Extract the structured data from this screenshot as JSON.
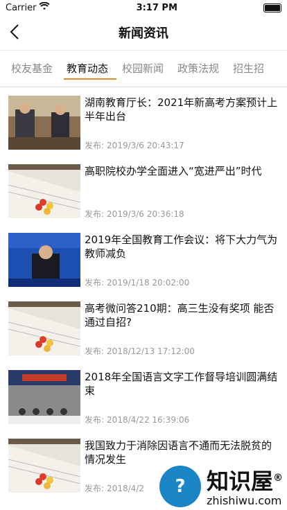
{
  "status": {
    "carrier": "Carrier",
    "time": "3:17 PM"
  },
  "nav": {
    "title": "新闻资讯"
  },
  "tabs": [
    {
      "label": "校友基金"
    },
    {
      "label": "教育动态"
    },
    {
      "label": "校园新闻"
    },
    {
      "label": "政策法规"
    },
    {
      "label": "招生招"
    }
  ],
  "items": [
    {
      "title": "湖南教育厅长：2021年新高考方案预计上半年出台",
      "pub": "发布:",
      "date": "2019/3/6 20:43:17"
    },
    {
      "title": "高职院校办学全面进入“宽进严出”时代",
      "pub": "发布:",
      "date": "2019/3/6 20:36:18"
    },
    {
      "title": "2019年全国教育工作会议：将下大力气为教师减负",
      "pub": "发布:",
      "date": "2019/1/18 20:02:00"
    },
    {
      "title": "高考微问答210期：高三生没有奖项 能否通过自招?",
      "pub": "发布:",
      "date": "2018/12/13 17:12:00"
    },
    {
      "title": "2018年全国语言文字工作督导培训圆满结束",
      "pub": "发布:",
      "date": "2018/4/22 16:39:06"
    },
    {
      "title": "我国致力于消除因语言不通而无法脱贫的情况发生",
      "pub": "发布:",
      "date": "2018/4/2"
    }
  ],
  "watermark": {
    "cn": "知识屋",
    "en": "zhishiwu.com",
    "mark": "®"
  }
}
